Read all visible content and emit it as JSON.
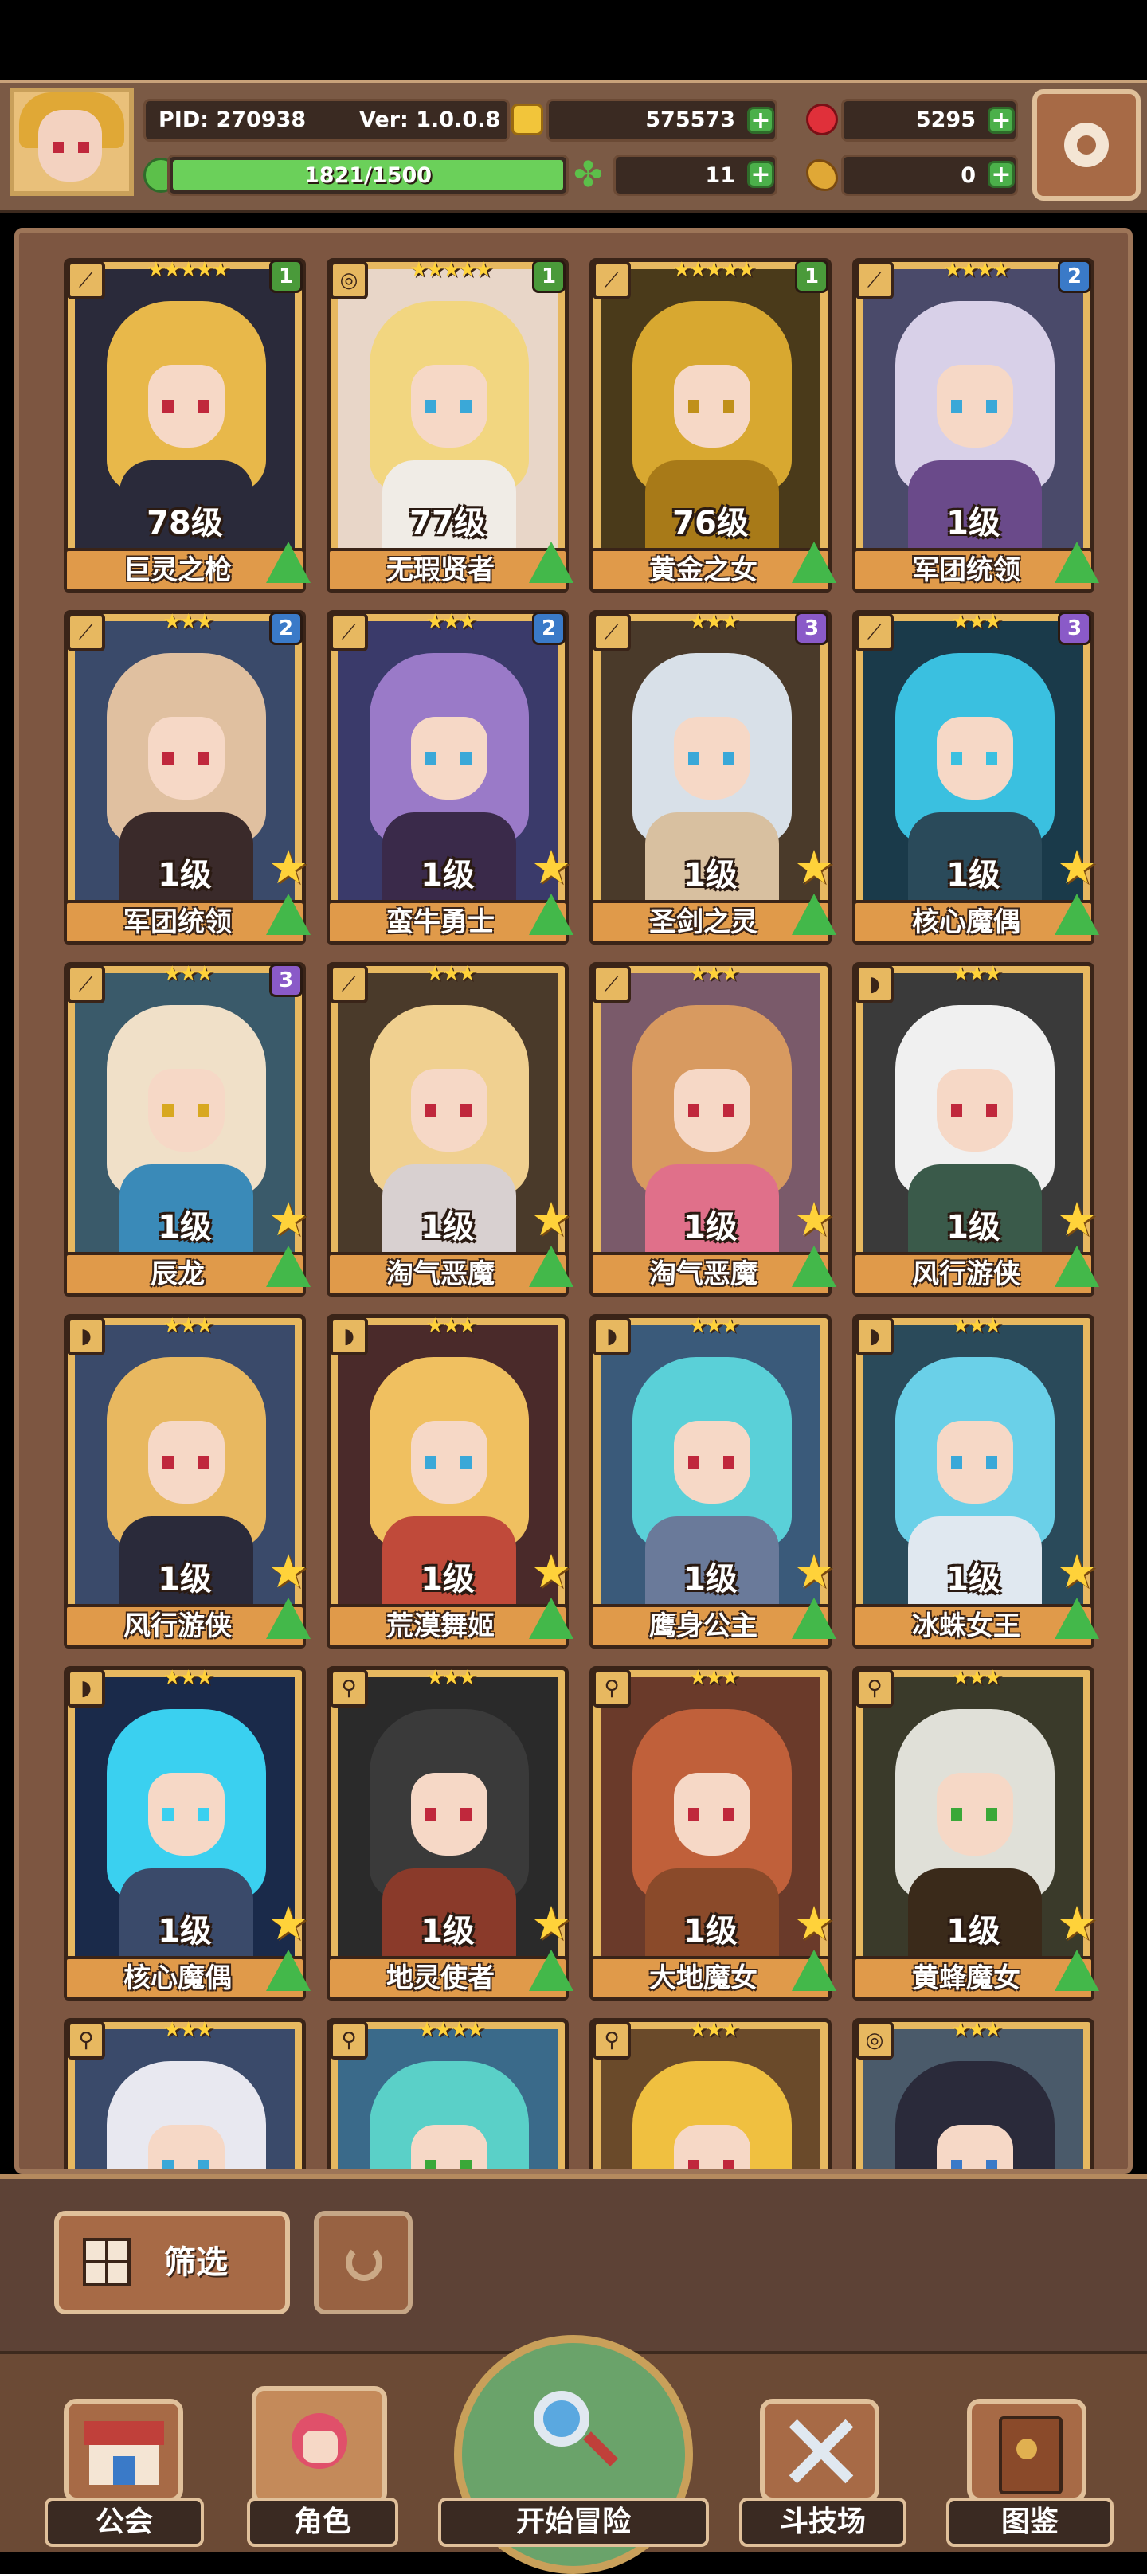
{
  "header": {
    "pid": "PID: 270938",
    "version": "Ver: 1.0.0.8",
    "gold": "575573",
    "gems": "5295",
    "stamina": "1821/1500",
    "clover": "11",
    "meat": "0"
  },
  "colors": {
    "panel_bg": "#7d5641",
    "card_frame": "#e7b860",
    "accent_green": "#43b84a",
    "badge_green": "#4a9a3a",
    "badge_blue": "#3a7ac8",
    "badge_purple": "#8a5ac8"
  },
  "heroes": [
    {
      "name": "巨灵之枪",
      "level": "78级",
      "stars": "★★★★★",
      "badge": "1",
      "class_icon": "spear-icon",
      "upgrade": true,
      "star_button": false
    },
    {
      "name": "无瑕贤者",
      "level": "77级",
      "stars": "★★★★★",
      "badge": "1",
      "class_icon": "orb-icon",
      "upgrade": true,
      "star_button": false
    },
    {
      "name": "黄金之女",
      "level": "76级",
      "stars": "★★★★★",
      "badge": "1",
      "class_icon": "spear-icon",
      "upgrade": true,
      "star_button": false
    },
    {
      "name": "军团统领",
      "level": "1级",
      "stars": "★★★★",
      "badge": "2",
      "class_icon": "spear-icon",
      "upgrade": true,
      "star_button": false
    },
    {
      "name": "军团统领",
      "level": "1级",
      "stars": "★★★",
      "badge": "2",
      "class_icon": "spear-icon",
      "upgrade": true,
      "star_button": true
    },
    {
      "name": "蛮牛勇士",
      "level": "1级",
      "stars": "★★★",
      "badge": "2",
      "class_icon": "spear-icon",
      "upgrade": true,
      "star_button": true
    },
    {
      "name": "圣剑之灵",
      "level": "1级",
      "stars": "★★★",
      "badge": "3",
      "class_icon": "spear-icon",
      "upgrade": true,
      "star_button": true
    },
    {
      "name": "核心魔偶",
      "level": "1级",
      "stars": "★★★",
      "badge": "3",
      "class_icon": "spear-icon",
      "upgrade": true,
      "star_button": true
    },
    {
      "name": "辰龙",
      "level": "1级",
      "stars": "★★★",
      "badge": "3",
      "class_icon": "spear-icon",
      "upgrade": true,
      "star_button": true
    },
    {
      "name": "淘气恶魔",
      "level": "1级",
      "stars": "★★★",
      "badge": "",
      "class_icon": "spear-icon",
      "upgrade": true,
      "star_button": true
    },
    {
      "name": "淘气恶魔",
      "level": "1级",
      "stars": "★★★",
      "badge": "",
      "class_icon": "spear-icon",
      "upgrade": true,
      "star_button": true
    },
    {
      "name": "风行游侠",
      "level": "1级",
      "stars": "★★★",
      "badge": "",
      "class_icon": "bow-icon",
      "upgrade": true,
      "star_button": true
    },
    {
      "name": "风行游侠",
      "level": "1级",
      "stars": "★★★",
      "badge": "",
      "class_icon": "bow-icon",
      "upgrade": true,
      "star_button": true
    },
    {
      "name": "荒漠舞姬",
      "level": "1级",
      "stars": "★★★",
      "badge": "",
      "class_icon": "bow-icon",
      "upgrade": true,
      "star_button": true
    },
    {
      "name": "鹰身公主",
      "level": "1级",
      "stars": "★★★",
      "badge": "",
      "class_icon": "bow-icon",
      "upgrade": true,
      "star_button": true
    },
    {
      "name": "冰蛛女王",
      "level": "1级",
      "stars": "★★★",
      "badge": "",
      "class_icon": "bow-icon",
      "upgrade": true,
      "star_button": true
    },
    {
      "name": "核心魔偶",
      "level": "1级",
      "stars": "★★★",
      "badge": "",
      "class_icon": "bow-icon",
      "upgrade": true,
      "star_button": true
    },
    {
      "name": "地灵使者",
      "level": "1级",
      "stars": "★★★",
      "badge": "",
      "class_icon": "wand-icon",
      "upgrade": true,
      "star_button": true
    },
    {
      "name": "大地魔女",
      "level": "1级",
      "stars": "★★★",
      "badge": "",
      "class_icon": "wand-icon",
      "upgrade": true,
      "star_button": true
    },
    {
      "name": "黄蜂魔女",
      "level": "1级",
      "stars": "★★★",
      "badge": "",
      "class_icon": "wand-icon",
      "upgrade": true,
      "star_button": true
    },
    {
      "name": "",
      "level": "",
      "stars": "★★★",
      "badge": "",
      "class_icon": "wand-icon",
      "upgrade": false,
      "star_button": false
    },
    {
      "name": "",
      "level": "",
      "stars": "★★★★",
      "badge": "",
      "class_icon": "wand-icon",
      "upgrade": false,
      "star_button": false
    },
    {
      "name": "",
      "level": "",
      "stars": "★★★",
      "badge": "",
      "class_icon": "wand-icon",
      "upgrade": false,
      "star_button": false
    },
    {
      "name": "",
      "level": "",
      "stars": "★★★",
      "badge": "",
      "class_icon": "orb-icon",
      "upgrade": false,
      "star_button": false
    }
  ],
  "controls": {
    "filter_label": "筛选"
  },
  "nav": {
    "guild": "公会",
    "character": "角色",
    "adventure": "开始冒险",
    "arena": "斗技场",
    "codex": "图鉴"
  }
}
